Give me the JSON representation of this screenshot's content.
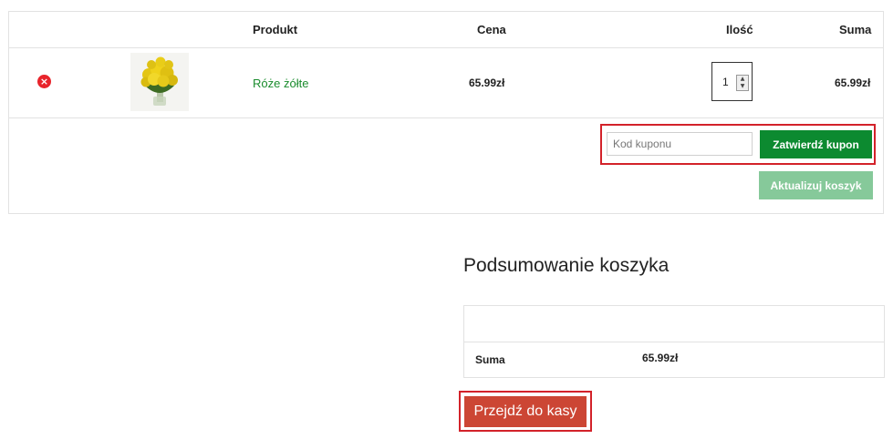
{
  "cart": {
    "headers": {
      "product": "Produkt",
      "price": "Cena",
      "quantity": "Ilość",
      "subtotal": "Suma"
    },
    "items": [
      {
        "name": "Róże żółte",
        "price": "65.99zł",
        "quantity": "1",
        "subtotal": "65.99zł",
        "remove_icon": "×"
      }
    ],
    "coupon": {
      "placeholder": "Kod kuponu",
      "apply_label": "Zatwierdź kupon"
    },
    "update_label": "Aktualizuj koszyk"
  },
  "totals": {
    "title": "Podsumowanie koszyka",
    "total_label": "Suma",
    "total_value": "65.99zł",
    "checkout_label": "Przejdź do kasy"
  },
  "colors": {
    "accent_green": "#0c8a30",
    "light_green": "#86c99a",
    "checkout_red": "#cc4634",
    "highlight_red": "#d3222a",
    "link_green": "#1b8c2e"
  }
}
